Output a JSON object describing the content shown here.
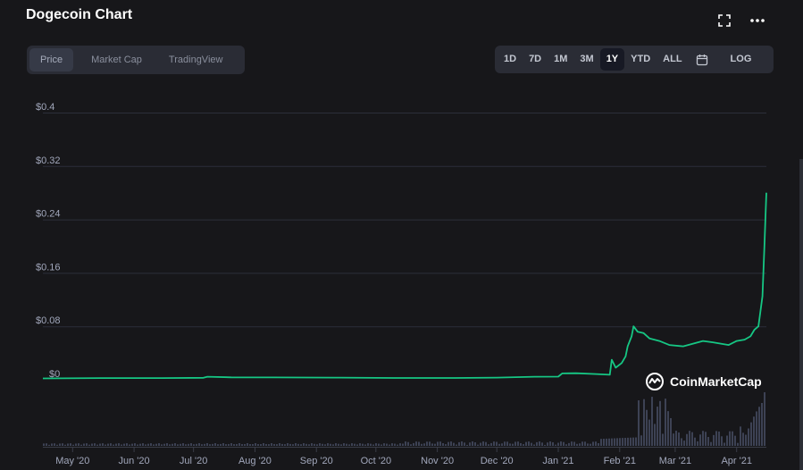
{
  "header": {
    "title": "Dogecoin Chart",
    "fullscreen_icon": "fullscreen-icon",
    "more_icon": "more-horizontal-icon"
  },
  "chart_tabs": [
    {
      "label": "Price",
      "active": true
    },
    {
      "label": "Market Cap",
      "active": false
    },
    {
      "label": "TradingView",
      "active": false
    }
  ],
  "time_ranges": [
    {
      "label": "1D",
      "active": false
    },
    {
      "label": "7D",
      "active": false
    },
    {
      "label": "1M",
      "active": false
    },
    {
      "label": "3M",
      "active": false
    },
    {
      "label": "1Y",
      "active": true
    },
    {
      "label": "YTD",
      "active": false
    },
    {
      "label": "ALL",
      "active": false
    }
  ],
  "calendar_icon": "calendar-icon",
  "log_label": "LOG",
  "watermark": {
    "text": "CoinMarketCap",
    "icon": "coinmarketcap-logo-icon"
  },
  "colors": {
    "background": "#17171a",
    "line": "#16c784",
    "grid": "#2c2f3a",
    "axis_text": "#a1a7bb",
    "volume": "#3d4254"
  },
  "chart_data": {
    "type": "line",
    "ylabel": "",
    "xlabel": "",
    "y_ticks": [
      "$0",
      "$0.08",
      "$0.16",
      "$0.24",
      "$0.32",
      "$0.4"
    ],
    "y_tick_values": [
      0,
      0.08,
      0.16,
      0.24,
      0.32,
      0.4
    ],
    "ylim": [
      0,
      0.4
    ],
    "x_ticks": [
      "May '20",
      "Jun '20",
      "Jul '20",
      "Aug '20",
      "Sep '20",
      "Oct '20",
      "Nov '20",
      "Dec '20",
      "Jan '21",
      "Feb '21",
      "Mar '21",
      "Apr '21"
    ],
    "x_tick_dates": [
      "2020-05-01",
      "2020-06-01",
      "2020-07-01",
      "2020-08-01",
      "2020-09-01",
      "2020-10-01",
      "2020-11-01",
      "2020-12-01",
      "2021-01-01",
      "2021-02-01",
      "2021-03-01",
      "2021-04-01"
    ],
    "xlim": [
      "2020-04-16",
      "2021-04-16"
    ],
    "grid": true,
    "series": [
      {
        "points": [
          [
            "2020-04-16",
            0.002
          ],
          [
            "2020-05-15",
            0.0025
          ],
          [
            "2020-06-15",
            0.0026
          ],
          [
            "2020-07-06",
            0.0029
          ],
          [
            "2020-07-08",
            0.0045
          ],
          [
            "2020-07-20",
            0.0036
          ],
          [
            "2020-08-10",
            0.0035
          ],
          [
            "2020-09-10",
            0.0032
          ],
          [
            "2020-10-10",
            0.0027
          ],
          [
            "2020-11-10",
            0.0027
          ],
          [
            "2020-12-01",
            0.0032
          ],
          [
            "2020-12-20",
            0.0045
          ],
          [
            "2021-01-01",
            0.0047
          ],
          [
            "2021-01-03",
            0.0095
          ],
          [
            "2021-01-10",
            0.0098
          ],
          [
            "2021-01-20",
            0.0085
          ],
          [
            "2021-01-27",
            0.0075
          ],
          [
            "2021-01-28",
            0.03
          ],
          [
            "2021-01-30",
            0.018
          ],
          [
            "2021-02-02",
            0.025
          ],
          [
            "2021-02-04",
            0.035
          ],
          [
            "2021-02-05",
            0.05
          ],
          [
            "2021-02-07",
            0.065
          ],
          [
            "2021-02-08",
            0.08
          ],
          [
            "2021-02-10",
            0.072
          ],
          [
            "2021-02-13",
            0.07
          ],
          [
            "2021-02-16",
            0.062
          ],
          [
            "2021-02-21",
            0.058
          ],
          [
            "2021-02-26",
            0.052
          ],
          [
            "2021-03-05",
            0.05
          ],
          [
            "2021-03-10",
            0.054
          ],
          [
            "2021-03-15",
            0.058
          ],
          [
            "2021-03-20",
            0.056
          ],
          [
            "2021-03-28",
            0.052
          ],
          [
            "2021-04-01",
            0.058
          ],
          [
            "2021-04-05",
            0.06
          ],
          [
            "2021-04-08",
            0.065
          ],
          [
            "2021-04-10",
            0.075
          ],
          [
            "2021-04-12",
            0.08
          ],
          [
            "2021-04-14",
            0.125
          ],
          [
            "2021-04-15",
            0.2
          ],
          [
            "2021-04-16",
            0.28
          ]
        ]
      }
    ]
  }
}
